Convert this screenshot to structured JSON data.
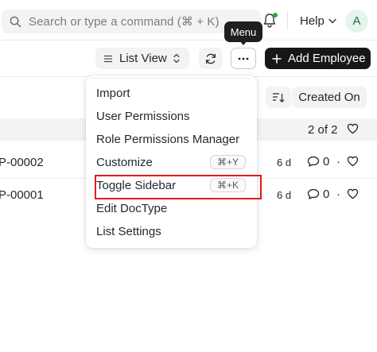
{
  "navbar": {
    "search_placeholder": "Search or type a command (⌘ + K)",
    "help_label": "Help",
    "avatar_initial": "A"
  },
  "toolbar": {
    "list_view_label": "List View",
    "menu_tooltip": "Menu",
    "add_label": "Add Employee"
  },
  "sort": {
    "field_label": "Created On"
  },
  "list": {
    "count_label": "2 of 2",
    "rows": [
      {
        "name": "P-00002",
        "time": "6 d",
        "comments": "0",
        "separator": "·"
      },
      {
        "name": "P-00001",
        "time": "6 d",
        "comments": "0",
        "separator": "·"
      }
    ]
  },
  "menu": {
    "items": [
      {
        "label": "Import",
        "shortcut": ""
      },
      {
        "label": "User Permissions",
        "shortcut": ""
      },
      {
        "label": "Role Permissions Manager",
        "shortcut": ""
      },
      {
        "label": "Customize",
        "shortcut": "⌘+Y"
      },
      {
        "label": "Toggle Sidebar",
        "shortcut": "⌘+K"
      },
      {
        "label": "Edit DocType",
        "shortcut": ""
      },
      {
        "label": "List Settings",
        "shortcut": ""
      }
    ]
  },
  "colors": {
    "highlight": "#e5191c",
    "primary_button": "#171717",
    "notification_dot": "#28a745"
  }
}
